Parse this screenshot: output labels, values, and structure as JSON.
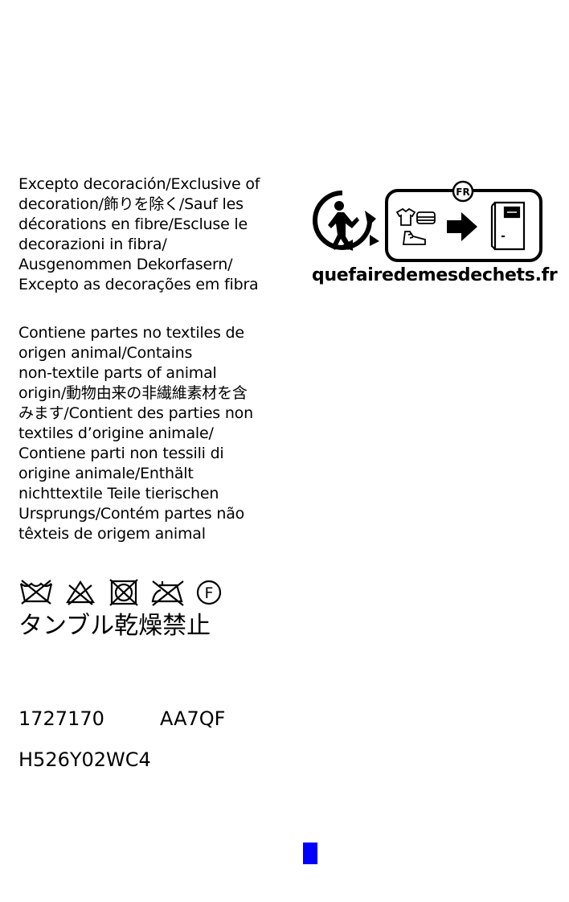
{
  "exclusion_notice": {
    "lines": [
      "Excepto decoración/Exclusive of",
      "decoration/飾りを除く/Sauf les",
      "décorations en fibre/Escluse le",
      "decorazioni in fibra/",
      "Ausgenommen Dekorfasern/",
      "Excepto as decorações em fibra"
    ]
  },
  "animal_parts_notice": {
    "lines": [
      "Contiene partes no textiles de",
      "origen animal/Contains",
      "non-textile parts of animal",
      "origin/動物由来の非繊維素材を含",
      "みます/Contient des parties non",
      "textiles d’origine animale/",
      "Contiene parti non tessili di",
      "origine animale/Enthält",
      "nichttextile Teile tierischen",
      "Ursprungs/Contém partes não",
      "têxteis de origem animal"
    ]
  },
  "care": {
    "symbols": [
      "do-not-wash-icon",
      "do-not-bleach-icon",
      "do-not-tumble-dry-icon",
      "do-not-iron-icon",
      "professional-dry-clean-f-icon"
    ],
    "dry_clean_letter": "F",
    "tumble_dry_text": "タンブル乾燥禁止"
  },
  "codes": {
    "style_number": "1727170",
    "lot_code": "AA7QF",
    "sku": "H526Y02WC4"
  },
  "triman": {
    "country_badge": "FR",
    "url": "quefairedemesdechets.fr"
  },
  "colors": {
    "text": "#000000",
    "background": "#ffffff",
    "marker": "#0000ff"
  }
}
